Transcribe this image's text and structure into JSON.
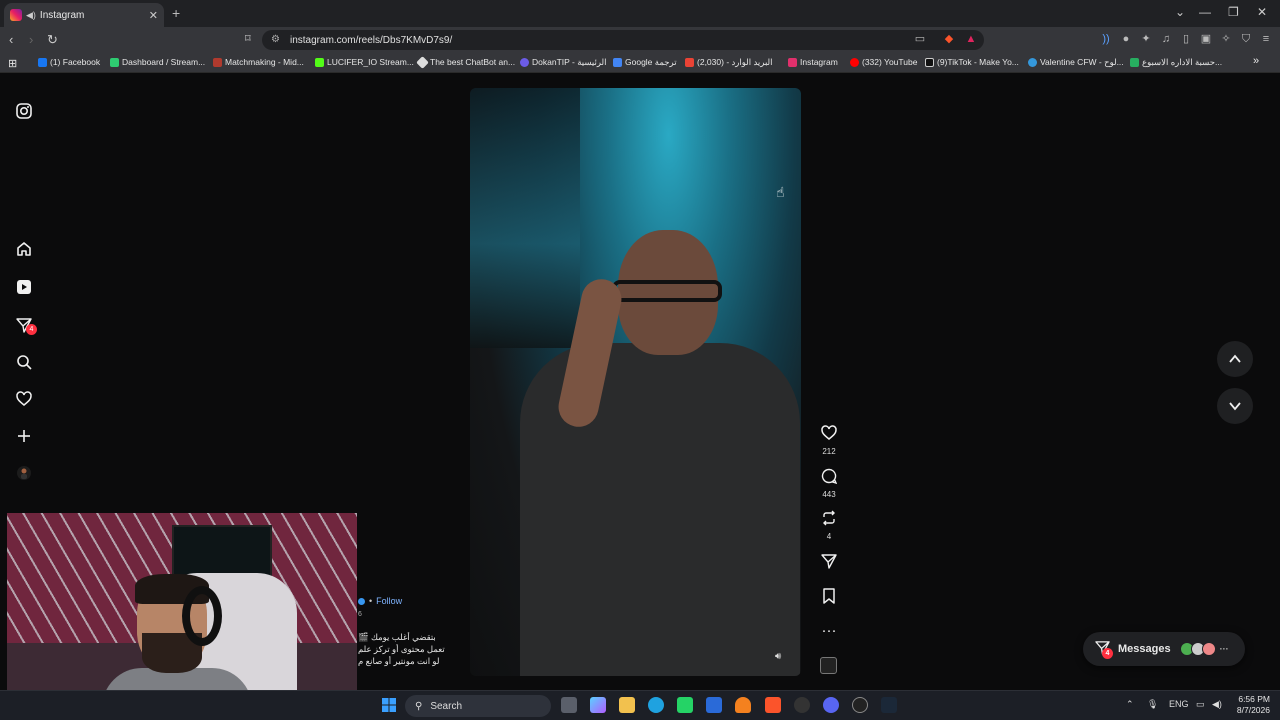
{
  "browser": {
    "tab": {
      "title": "Instagram",
      "close": "✕"
    },
    "new_tab": "+",
    "url": "instagram.com/reels/Dbs7KMvD7s9/",
    "window_controls": [
      "⌄",
      "—",
      "❐",
      "✕"
    ],
    "bookmarks": [
      {
        "label": "(1) Facebook",
        "color": "#1877f2"
      },
      {
        "label": "Dashboard / Stream...",
        "color": "#2ecc71"
      },
      {
        "label": "Matchmaking - Mid...",
        "color": "#b03a2e"
      },
      {
        "label": "LUCIFER_IO Stream...",
        "color": "#53fc18"
      },
      {
        "label": "The best ChatBot an...",
        "color": "#dddddd"
      },
      {
        "label": "DokanTIP - الرئيسية",
        "color": "#6c5ce7"
      },
      {
        "label": "Google ترجمة",
        "color": "#4285f4"
      },
      {
        "label": "البريد الوارد - (2,030)",
        "color": "#ea4335"
      },
      {
        "label": "Instagram",
        "color": "#e1306c"
      },
      {
        "label": "(332) YouTube",
        "color": "#ff0000"
      },
      {
        "label": "(9)TikTok - Make Yo...",
        "color": "#111111"
      },
      {
        "label": "Valentine CFW - لوح...",
        "color": "#3498db"
      },
      {
        "label": "حسبة الاداره الاسبوع...",
        "color": "#27ae60"
      }
    ],
    "bookmarks_more": "»"
  },
  "sidebar": {
    "badge_count": "4"
  },
  "reel": {
    "actions": {
      "likes": "212",
      "comments": "443",
      "reposts": "4"
    },
    "follow_label": "Follow",
    "caption_count": "6",
    "caption_lines": [
      "بتقضي أغلب يومك 🎬",
      "تعمل محتوى أو تركز علم",
      "لو انت مونتير أو صانع م"
    ]
  },
  "messages": {
    "label": "Messages",
    "badge": "4",
    "more": "···"
  },
  "taskbar": {
    "search_placeholder": "Search",
    "language": "ENG",
    "time": "6:56 PM",
    "date": "8/7/2026"
  },
  "colors": {
    "badge": "#ff3040",
    "link": "#7fb4ff",
    "instagram_gradient": [
      "#f9a825",
      "#e91e63",
      "#7b1fa2"
    ]
  }
}
